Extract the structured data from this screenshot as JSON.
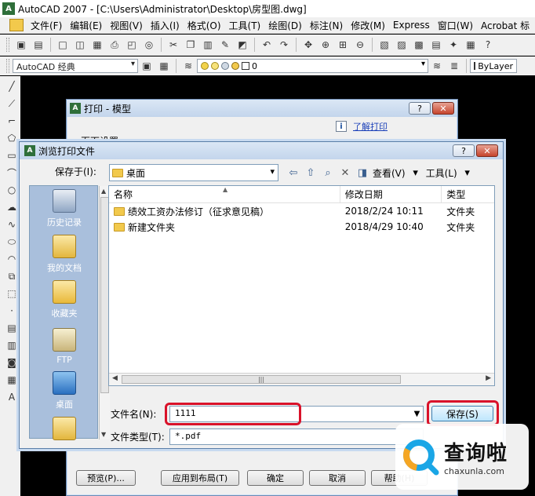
{
  "window": {
    "title": "AutoCAD 2007 - [C:\\Users\\Administrator\\Desktop\\房型图.dwg]",
    "app_icon_text": "A"
  },
  "menu": [
    "文件(F)",
    "编辑(E)",
    "视图(V)",
    "插入(I)",
    "格式(O)",
    "工具(T)",
    "绘图(D)",
    "标注(N)",
    "修改(M)",
    "Express",
    "窗口(W)",
    "Acrobat 标"
  ],
  "toolbar": {
    "workspace": "AutoCAD 经典",
    "layer_value": "0",
    "linetype": "ByLayer"
  },
  "plot_dialog": {
    "title": "打印 - 模型",
    "help_link": "了解打印",
    "page_setup_label": "页面设置",
    "buttons": {
      "preview": "预览(P)...",
      "apply": "应用到布局(T)",
      "ok": "确定",
      "cancel": "取消",
      "help": "帮助(H)"
    }
  },
  "browse_dialog": {
    "title": "浏览打印文件",
    "save_in_label": "保存于(I):",
    "save_in_value": "桌面",
    "views_label": "查看(V)",
    "tools_label": "工具(L)",
    "places": [
      "历史记录",
      "我的文档",
      "收藏夹",
      "FTP",
      "桌面"
    ],
    "columns": {
      "name": "名称",
      "date": "修改日期",
      "type": "类型"
    },
    "files": [
      {
        "name": "绩效工资办法修订（征求意见稿）",
        "date": "2018/2/24 10:11",
        "type": "文件夹"
      },
      {
        "name": "新建文件夹",
        "date": "2018/4/29 10:40",
        "type": "文件夹"
      }
    ],
    "filename_label": "文件名(N):",
    "filename_value": "1111",
    "filetype_label": "文件类型(T):",
    "filetype_value": "*.pdf",
    "save_button": "保存(S)"
  },
  "watermark": {
    "brand_cn": "查询啦",
    "url": "chaxunla.com"
  },
  "colors": {
    "highlight_red": "#d9122a",
    "places_bar": "#a9bfdc",
    "titlebar": "#c3d5ec"
  }
}
